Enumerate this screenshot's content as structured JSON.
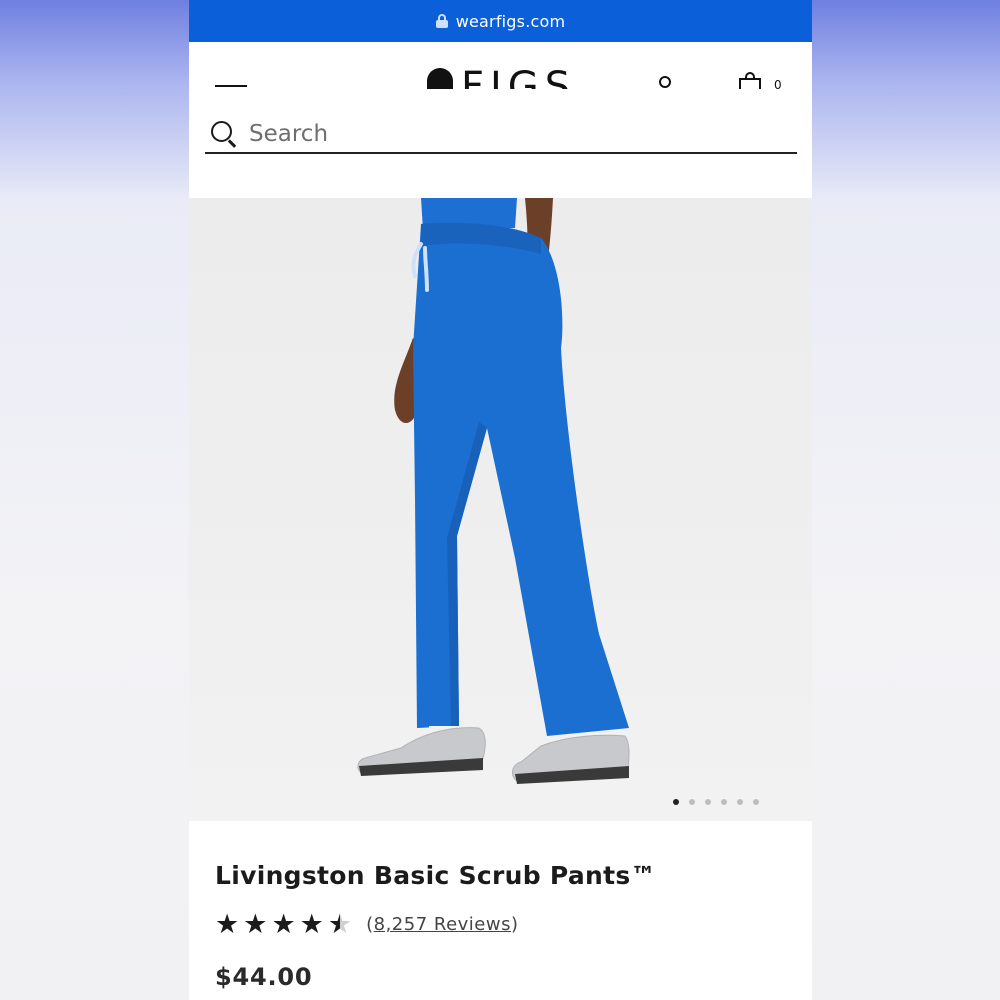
{
  "browser": {
    "url": "wearfigs.com",
    "lock_icon": "lock-icon"
  },
  "header": {
    "logo_text": "FIGS",
    "icons": [
      "menu-icon",
      "account-icon",
      "bag-icon"
    ],
    "bag_count": "0"
  },
  "search": {
    "placeholder": "Search",
    "value": ""
  },
  "product": {
    "image_alt": "Blue scrub pants on model",
    "gallery_count": 6,
    "gallery_active_index": 0,
    "title": "Livingston Basic Scrub Pants™",
    "rating": 4.5,
    "rating_max": 5,
    "reviews_open": "(",
    "reviews_count_text": "8,257 Reviews",
    "reviews_close": ")",
    "price": "$44.00"
  },
  "colors": {
    "browser_bar": "#0b5fd9",
    "pants": "#1b6fd0",
    "text": "#1b1b1b"
  }
}
